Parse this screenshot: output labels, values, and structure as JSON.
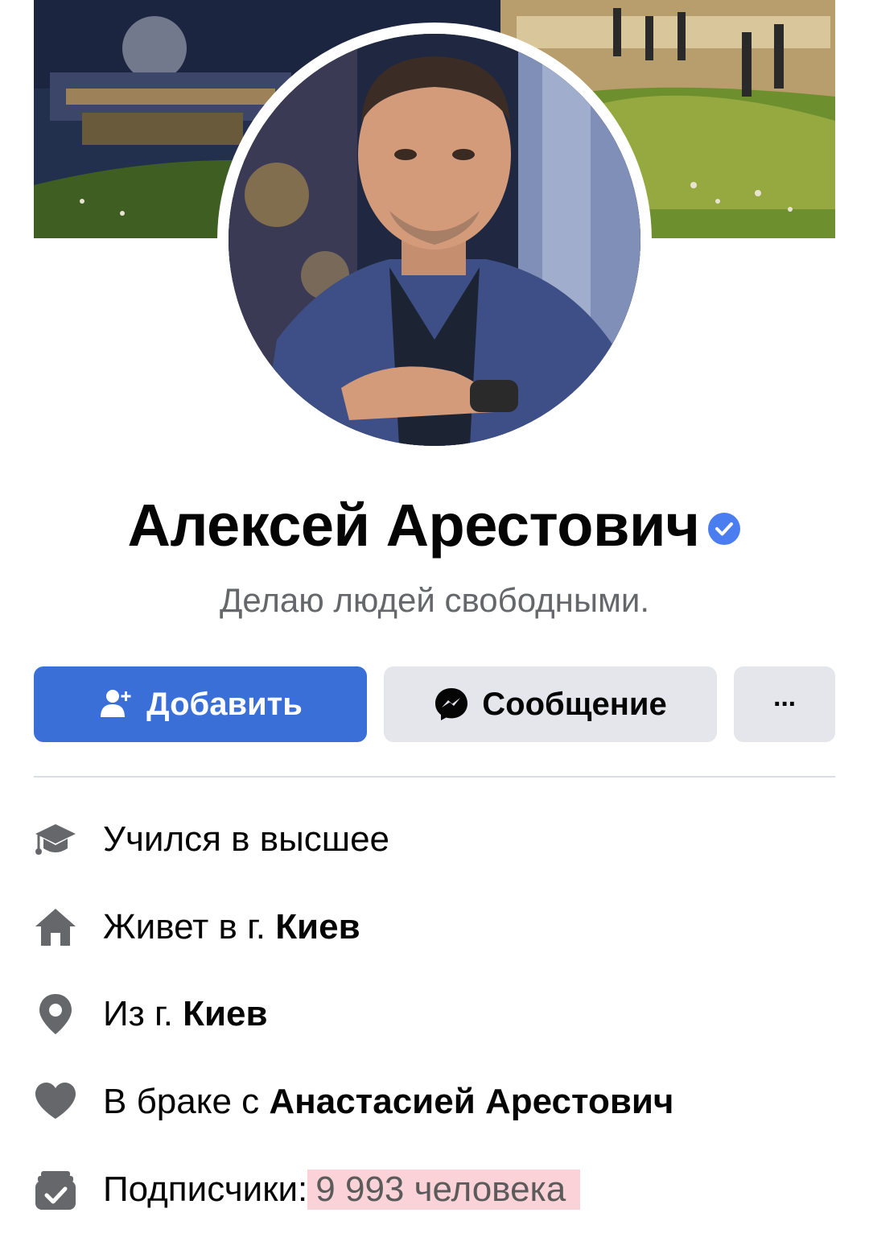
{
  "profile": {
    "name": "Алексей Арестович",
    "verified": true,
    "bio": "Делаю людей свободными."
  },
  "actions": {
    "add_label": "Добавить",
    "message_label": "Сообщение",
    "more_label": "···"
  },
  "info": {
    "education": {
      "icon": "graduation-cap-icon",
      "text": "Учился в высшее"
    },
    "lives_in": {
      "icon": "home-icon",
      "prefix": "Живет в г. ",
      "value": "Киев"
    },
    "from": {
      "icon": "location-pin-icon",
      "prefix": "Из г. ",
      "value": "Киев"
    },
    "relationship": {
      "icon": "heart-icon",
      "prefix": "В браке с ",
      "value": "Анастасией Арестович"
    },
    "followers": {
      "icon": "followers-icon",
      "prefix": "Подписчики:",
      "value": "9 993 человека"
    }
  },
  "colors": {
    "primary_button": "#3a6fd8",
    "secondary_button": "#e4e6eb",
    "verified_badge": "#4a7ef0",
    "highlight": "#fbd2d8"
  }
}
